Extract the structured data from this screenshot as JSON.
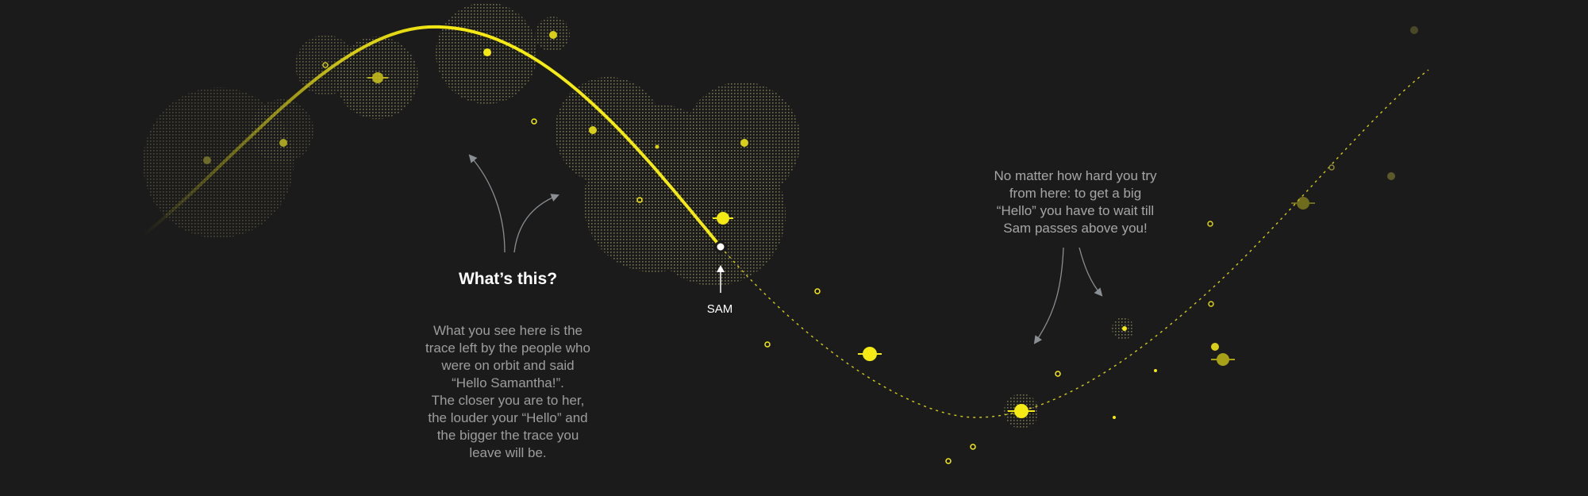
{
  "colors": {
    "background": "#1b1b1b",
    "accent_yellow": "#f5ea14",
    "trace_fill": "#8f8a55",
    "annotation_arrow": "#8a8f94",
    "body_text": "#9d9d9d",
    "heading_text": "#ffffff"
  },
  "explainer": {
    "heading": "What’s this?",
    "lines": [
      "What you see here is the",
      "trace left by the people who",
      "were on orbit and said",
      "“Hello Samantha!”.",
      "The closer you are to her,",
      "the louder your “Hello” and",
      "the bigger the trace you",
      "leave will be."
    ]
  },
  "note": {
    "lines": [
      "No matter how hard you try",
      "from here: to get a big",
      "“Hello” you have to wait till",
      "Sam passes above you!"
    ]
  },
  "satellite": {
    "label": "SAM"
  }
}
